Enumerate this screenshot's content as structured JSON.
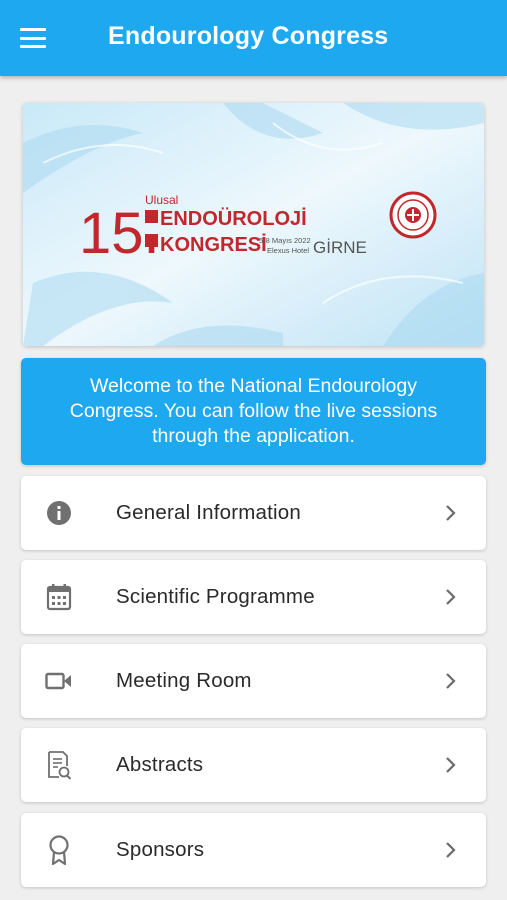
{
  "appbar": {
    "title": "Endourology Congress",
    "color": "#1ea8f0"
  },
  "banner": {
    "number": "15.",
    "ulusal": "Ulusal",
    "line1": "ENDOÜROLOJİ",
    "line2": "KONGRESİ",
    "dates": "5-8 Mayıs 2022",
    "venue": "Elexus Hotel",
    "city": "GİRNE",
    "accent_color": "#c1272d"
  },
  "welcome": {
    "text": "Welcome to the National Endourology Congress. You can follow the live sessions through the application."
  },
  "menu": [
    {
      "label": "General Information",
      "icon": "info-icon"
    },
    {
      "label": "Scientific Programme",
      "icon": "calendar-icon"
    },
    {
      "label": "Meeting Room",
      "icon": "video-camera-icon"
    },
    {
      "label": "Abstracts",
      "icon": "document-search-icon"
    },
    {
      "label": "Sponsors",
      "icon": "award-ribbon-icon"
    }
  ]
}
